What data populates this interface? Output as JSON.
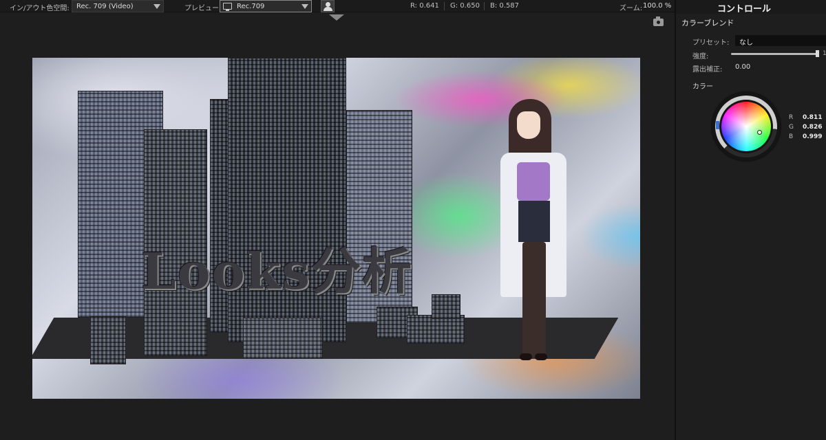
{
  "toolbar": {
    "in_out_label": "イン/アウト色空間:",
    "in_out_value": "Rec. 709 (Video)",
    "preview_label": "プレビュー:",
    "preview_value": "Rec.709",
    "r_label": "R: 0.641",
    "g_label": "G: 0.650",
    "b_label": "B: 0.587",
    "zoom_label": "ズーム:",
    "zoom_value": "100.0 %"
  },
  "viewer": {
    "title_text": "Looks分析"
  },
  "panel": {
    "title": "コントロール",
    "section": "カラーブレンド",
    "preset_label": "プリセット:",
    "preset_value": "なし",
    "strength_label": "強度:",
    "strength_level": 0.98,
    "strength_cut_value": "1",
    "exposure_label": "露出補正:",
    "exposure_value": "0.00",
    "color_label": "カラー",
    "rgb": {
      "r_key": "R",
      "r_value": "0.811",
      "g_key": "G",
      "g_value": "0.826",
      "b_key": "B",
      "b_value": "0.999"
    }
  },
  "icons": [
    "dropdown-arrow-icon",
    "monitor-icon",
    "person-icon",
    "camera-icon",
    "viewer-notch-icon"
  ],
  "colors": {
    "accent": "#3a6fd0",
    "panel_bg": "#1e1e1e",
    "toolbar_bg": "#1b1b1b"
  }
}
